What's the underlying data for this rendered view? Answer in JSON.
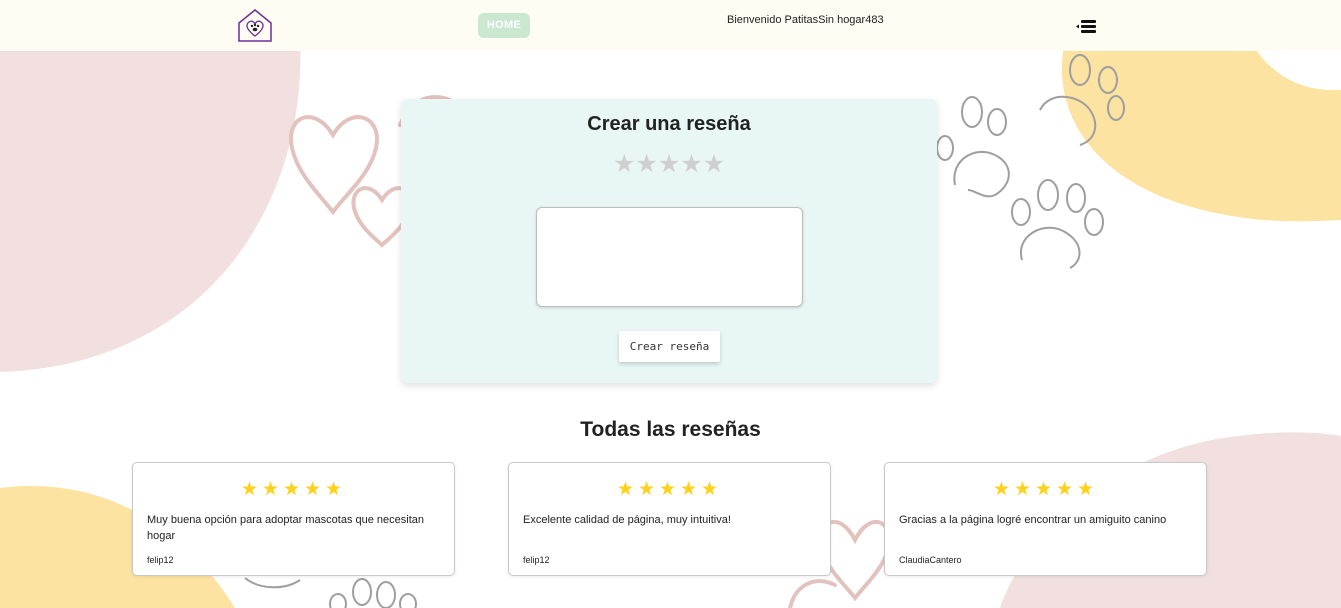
{
  "navbar": {
    "home_label": "HOME",
    "welcome_text": "Bienvenido PatitasSin hogar483",
    "logo_icon": "house-paw-logo-icon",
    "menu_icon": "menu-collapse-icon"
  },
  "create_review": {
    "title": "Crear una reseña",
    "rating": 0,
    "max_rating": 5,
    "stars": [
      "★",
      "★",
      "★",
      "★",
      "★"
    ],
    "textarea_value": "",
    "button_label": "Crear reseña"
  },
  "reviews_section": {
    "title": "Todas las reseñas",
    "reviews": [
      {
        "stars": "★★★★★",
        "rating": 5,
        "text": "Muy buena opción para adoptar mascotas que necesitan hogar",
        "author": "felip12"
      },
      {
        "stars": "★★★★★",
        "rating": 5,
        "text": "Excelente calidad de página, muy intuitiva!",
        "author": "felip12"
      },
      {
        "stars": "★★★★★",
        "rating": 5,
        "text": "Gracias a la página logré encontrar un amiguito canino",
        "author": "ClaudiaCantero"
      }
    ]
  },
  "colors": {
    "navbar_bg": "#fffcf3",
    "home_button_bg": "#c9e8cf",
    "create_card_bg": "#e8f6f5",
    "star_filled": "#ffd11a",
    "star_empty": "#cfcfcf",
    "blob_pink": "#f1e0df",
    "blob_yellow": "#fde3a1"
  }
}
